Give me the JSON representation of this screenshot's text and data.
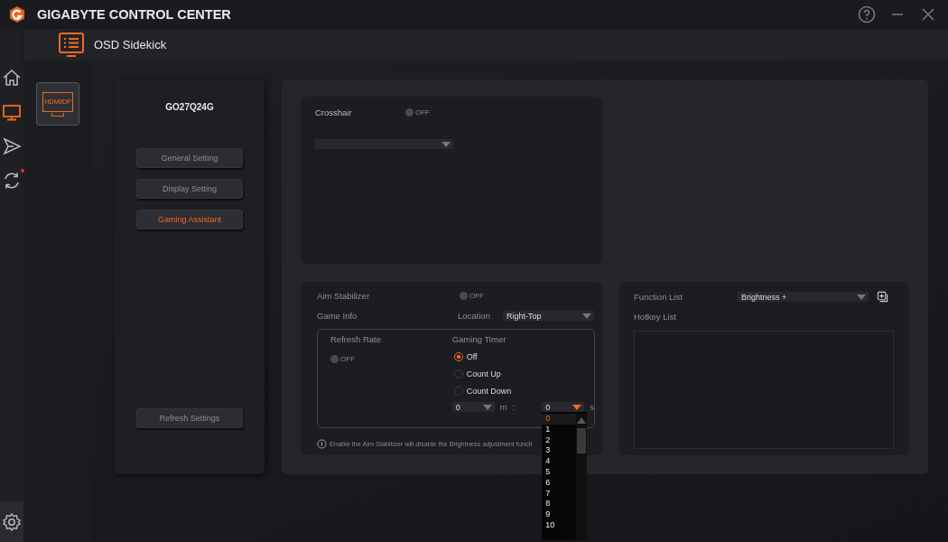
{
  "window": {
    "title": "GIGABYTE CONTROL CENTER"
  },
  "header": {
    "title": "OSD Sidekick"
  },
  "nav": [
    {
      "kind": "home",
      "selected": false,
      "notification": false
    },
    {
      "kind": "monitor",
      "selected": true,
      "notification": false
    },
    {
      "kind": "send",
      "selected": false,
      "notification": false
    },
    {
      "kind": "sync",
      "selected": false,
      "notification": true
    }
  ],
  "device_tab": {
    "label": "HDMI/DP",
    "selected": true
  },
  "device": {
    "name": "GO27Q24G",
    "menu": [
      {
        "label": "General Setting",
        "selected": false
      },
      {
        "label": "Display Setting",
        "selected": false
      },
      {
        "label": "Gaming Assistant",
        "selected": true
      }
    ],
    "refresh_button": "Refresh Settings"
  },
  "crosshair": {
    "label": "Crosshair",
    "on": false,
    "toggle_text": "OFF"
  },
  "aim_stabilizer": {
    "label": "Aim Stabilizer",
    "on": false,
    "toggle_text": "OFF"
  },
  "game_info": {
    "label": "Game Info",
    "location_label": "Location",
    "location_value": "Right-Top",
    "refresh_rate": {
      "label": "Refresh Rate",
      "on": false,
      "toggle_text": "OFF"
    },
    "gaming_timer": {
      "label": "Gaming Timer",
      "options": [
        {
          "label": "Off",
          "selected": true
        },
        {
          "label": "Count Up",
          "selected": false
        },
        {
          "label": "Count Down",
          "selected": false
        }
      ],
      "minutes": "0",
      "minutes_unit": "m",
      "separator": ":",
      "seconds": "0",
      "seconds_unit": "s",
      "seconds_open": true,
      "seconds_options": [
        {
          "label": "0",
          "selected": true
        },
        {
          "label": "1",
          "selected": false
        },
        {
          "label": "2",
          "selected": false
        },
        {
          "label": "3",
          "selected": false
        },
        {
          "label": "4",
          "selected": false
        },
        {
          "label": "5",
          "selected": false
        },
        {
          "label": "6",
          "selected": false
        },
        {
          "label": "7",
          "selected": false
        },
        {
          "label": "8",
          "selected": false
        },
        {
          "label": "9",
          "selected": false
        },
        {
          "label": "10",
          "selected": false
        }
      ]
    },
    "note": "Enable the Aim Stabilizer will disable the Brightness adjustment functi"
  },
  "hotkeys": {
    "function_list_label": "Function List",
    "function_value": "Brightness +",
    "hotkey_list_label": "Hotkey List"
  }
}
